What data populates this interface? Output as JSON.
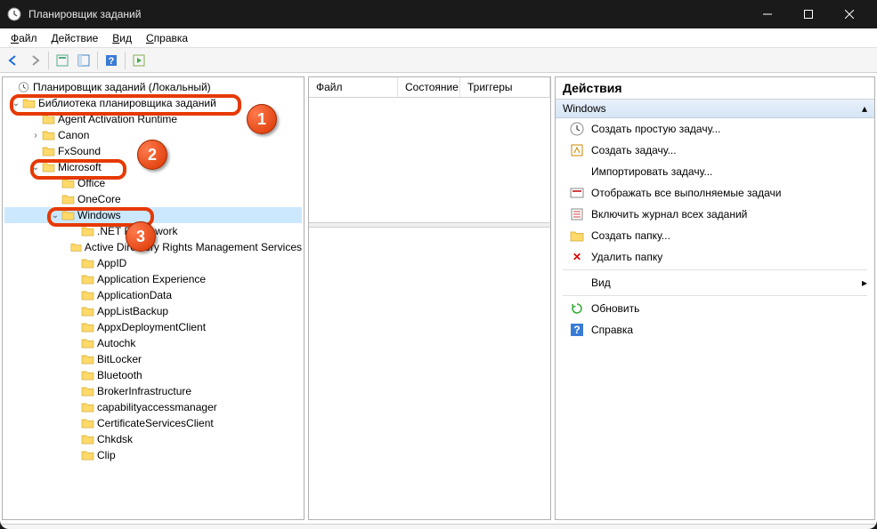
{
  "window": {
    "title": "Планировщик заданий"
  },
  "menu": {
    "file": "Файл",
    "action": "Действие",
    "view": "Вид",
    "help": "Справка"
  },
  "tree": {
    "root": "Планировщик заданий (Локальный)",
    "library": "Библиотека планировщика заданий",
    "items_l1": [
      "Agent Activation Runtime",
      "Canon",
      "FxSound",
      "Microsoft"
    ],
    "items_ms": [
      "Office",
      "OneCore",
      "Windows"
    ],
    "items_win": [
      ".NET Framework",
      "Active Directory Rights Management Services",
      "AppID",
      "Application Experience",
      "ApplicationData",
      "AppListBackup",
      "AppxDeploymentClient",
      "Autochk",
      "BitLocker",
      "Bluetooth",
      "BrokerInfrastructure",
      "capabilityaccessmanager",
      "CertificateServicesClient",
      "Chkdsk",
      "Clip"
    ]
  },
  "mid": {
    "c1": "Файл",
    "c2": "Состояние",
    "c3": "Триггеры"
  },
  "actions": {
    "title": "Действия",
    "section": "Windows",
    "create_basic": "Создать простую задачу...",
    "create": "Создать задачу...",
    "import": "Импортировать задачу...",
    "show_running": "Отображать все выполняемые задачи",
    "enable_history": "Включить журнал всех заданий",
    "new_folder": "Создать папку...",
    "delete_folder": "Удалить папку",
    "view": "Вид",
    "refresh": "Обновить",
    "help": "Справка"
  },
  "callouts": {
    "b1": "1",
    "b2": "2",
    "b3": "3"
  }
}
